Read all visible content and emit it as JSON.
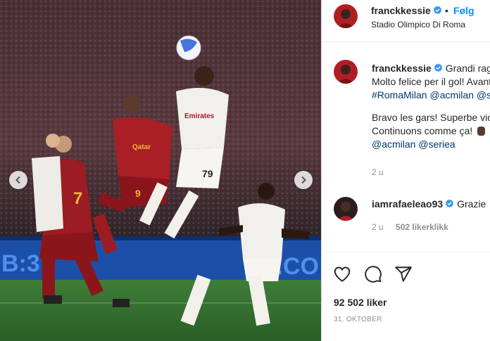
{
  "header": {
    "username": "franckkessie",
    "separator": "•",
    "follow_label": "Følg",
    "location": "Stadio Olimpico Di Roma"
  },
  "caption": {
    "username": "franckkessie",
    "line1": "Grandi ragazzi!",
    "line2": "Molto felice per il gol! Avanti!",
    "hashtag": "#RomaMilan",
    "mention1": "@acmilan",
    "mention_extra": "@seriea",
    "line3": "Bravo les gars! Superbe victoire",
    "line4": "Continuons comme ça!",
    "mention2": "@acmilan",
    "mention3": "@seriea",
    "time": "2 u"
  },
  "comment": {
    "username": "iamrafaeleao93",
    "text": "Grazie",
    "time": "2 u",
    "likes_label": "502 likerklikk"
  },
  "actions": {
    "likes": "92 502 liker",
    "date": "31. OKTOBER"
  },
  "photo": {
    "banner_left": "B:3",
    "banner_right": "R.CO",
    "shirt_number_roma": "9",
    "shirt_number_roma2": "7",
    "shirt_number_milan": "79",
    "sponsor_roma": "Qatar",
    "sponsor_milan": "Emirates"
  },
  "colors": {
    "accent": "#0095f6",
    "link": "#00376b",
    "roma": "#9b1c22",
    "milan_white": "#f2f0ea",
    "pitch": "#2d6a2c"
  },
  "icons": [
    "chevron-left-icon",
    "chevron-right-icon",
    "verified-icon",
    "heart-icon",
    "comment-icon",
    "share-icon"
  ]
}
